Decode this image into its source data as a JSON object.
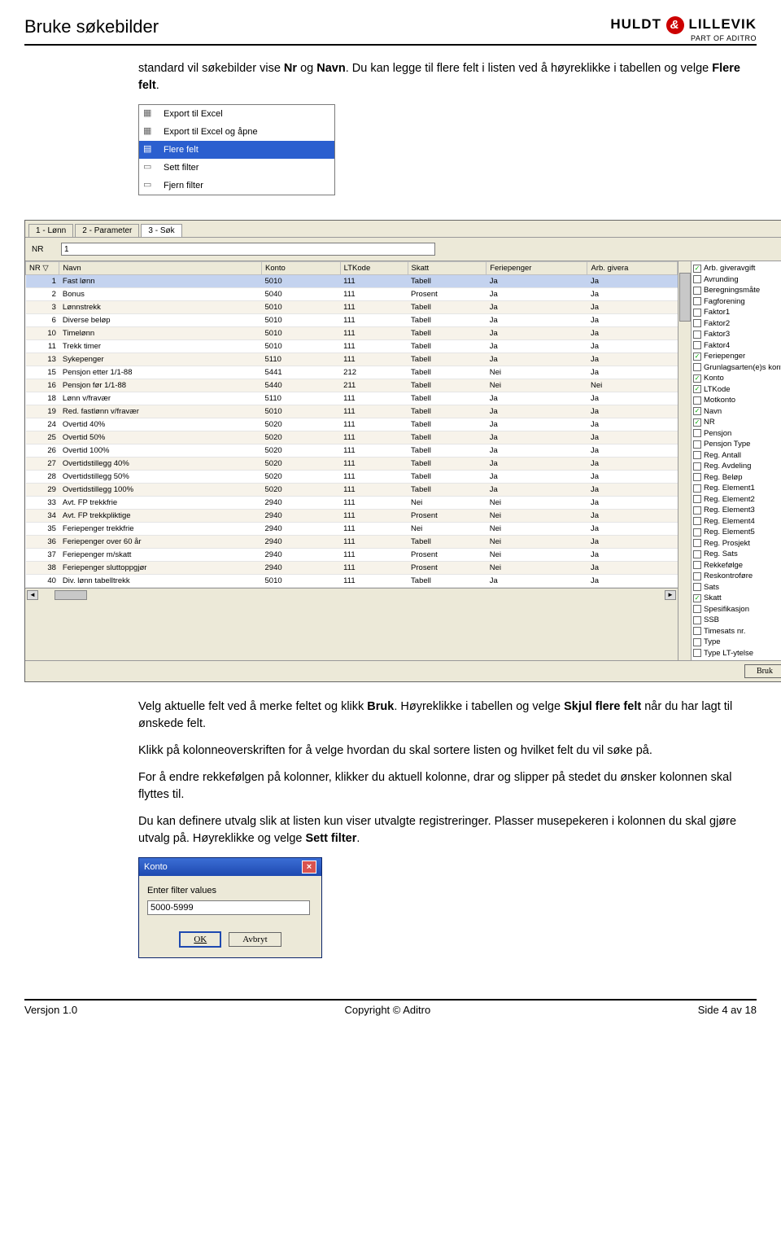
{
  "header": {
    "doc_title": "Bruke søkebilder",
    "logo_left": "HULDT",
    "logo_right": "LILLEVIK",
    "logo_sub": "PART OF ADITRO"
  },
  "intro_para_pre": "standard vil søkebilder vise ",
  "intro_bold1": "Nr",
  "intro_mid": " og ",
  "intro_bold2": "Navn",
  "intro_after": ". Du kan legge til flere felt i listen ved å høyreklikke i tabellen og velge ",
  "intro_bold3": "Flere felt",
  "intro_end": ".",
  "ctx_menu": [
    {
      "label": "Export til Excel",
      "sel": false
    },
    {
      "label": "Export til Excel og åpne",
      "sel": false
    },
    {
      "label": "Flere felt",
      "sel": true
    },
    {
      "label": "Sett filter",
      "sel": false
    },
    {
      "label": "Fjern filter",
      "sel": false
    }
  ],
  "app": {
    "tabs": [
      "1 - Lønn",
      "2 - Parameter",
      "3 - Søk"
    ],
    "active_tab": 2,
    "filter_label": "NR",
    "filter_value": "1",
    "columns": [
      "NR",
      "Navn",
      "Konto",
      "LTKode",
      "Skatt",
      "Feriepenger",
      "Arb. givera"
    ],
    "rows": [
      [
        "1",
        "Fast lønn",
        "5010",
        "111",
        "Tabell",
        "Ja",
        "Ja"
      ],
      [
        "2",
        "Bonus",
        "5040",
        "111",
        "Prosent",
        "Ja",
        "Ja"
      ],
      [
        "3",
        "Lønnstrekk",
        "5010",
        "111",
        "Tabell",
        "Ja",
        "Ja"
      ],
      [
        "6",
        "Diverse beløp",
        "5010",
        "111",
        "Tabell",
        "Ja",
        "Ja"
      ],
      [
        "10",
        "Timelønn",
        "5010",
        "111",
        "Tabell",
        "Ja",
        "Ja"
      ],
      [
        "11",
        "Trekk timer",
        "5010",
        "111",
        "Tabell",
        "Ja",
        "Ja"
      ],
      [
        "13",
        "Sykepenger",
        "5110",
        "111",
        "Tabell",
        "Ja",
        "Ja"
      ],
      [
        "15",
        "Pensjon etter 1/1-88",
        "5441",
        "212",
        "Tabell",
        "Nei",
        "Ja"
      ],
      [
        "16",
        "Pensjon før 1/1-88",
        "5440",
        "211",
        "Tabell",
        "Nei",
        "Nei"
      ],
      [
        "18",
        "Lønn v/fravær",
        "5110",
        "111",
        "Tabell",
        "Ja",
        "Ja"
      ],
      [
        "19",
        "Red. fastlønn v/fravær",
        "5010",
        "111",
        "Tabell",
        "Ja",
        "Ja"
      ],
      [
        "24",
        "Overtid 40%",
        "5020",
        "111",
        "Tabell",
        "Ja",
        "Ja"
      ],
      [
        "25",
        "Overtid 50%",
        "5020",
        "111",
        "Tabell",
        "Ja",
        "Ja"
      ],
      [
        "26",
        "Overtid 100%",
        "5020",
        "111",
        "Tabell",
        "Ja",
        "Ja"
      ],
      [
        "27",
        "Overtidstillegg 40%",
        "5020",
        "111",
        "Tabell",
        "Ja",
        "Ja"
      ],
      [
        "28",
        "Overtidstillegg 50%",
        "5020",
        "111",
        "Tabell",
        "Ja",
        "Ja"
      ],
      [
        "29",
        "Overtidstillegg 100%",
        "5020",
        "111",
        "Tabell",
        "Ja",
        "Ja"
      ],
      [
        "33",
        "Avt. FP trekkfrie",
        "2940",
        "111",
        "Nei",
        "Nei",
        "Ja"
      ],
      [
        "34",
        "Avt. FP trekkpliktige",
        "2940",
        "111",
        "Prosent",
        "Nei",
        "Ja"
      ],
      [
        "35",
        "Feriepenger trekkfrie",
        "2940",
        "111",
        "Nei",
        "Nei",
        "Ja"
      ],
      [
        "36",
        "Feriepenger over 60 år",
        "2940",
        "111",
        "Tabell",
        "Nei",
        "Ja"
      ],
      [
        "37",
        "Feriepenger m/skatt",
        "2940",
        "111",
        "Prosent",
        "Nei",
        "Ja"
      ],
      [
        "38",
        "Feriepenger sluttoppgjør",
        "2940",
        "111",
        "Prosent",
        "Nei",
        "Ja"
      ],
      [
        "40",
        "Div. lønn tabelltrekk",
        "5010",
        "111",
        "Tabell",
        "Ja",
        "Ja"
      ]
    ],
    "fields": [
      {
        "name": "Arb. giveravgift",
        "c": true
      },
      {
        "name": "Avrunding",
        "c": false
      },
      {
        "name": "Beregningsmåte",
        "c": false
      },
      {
        "name": "Fagforening",
        "c": false
      },
      {
        "name": "Faktor1",
        "c": false
      },
      {
        "name": "Faktor2",
        "c": false
      },
      {
        "name": "Faktor3",
        "c": false
      },
      {
        "name": "Faktor4",
        "c": false
      },
      {
        "name": "Feriepenger",
        "c": true
      },
      {
        "name": "Grunlagsarten(e)s kontostreng",
        "c": false
      },
      {
        "name": "Konto",
        "c": true
      },
      {
        "name": "LTKode",
        "c": true
      },
      {
        "name": "Motkonto",
        "c": false
      },
      {
        "name": "Navn",
        "c": true
      },
      {
        "name": "NR",
        "c": true
      },
      {
        "name": "Pensjon",
        "c": false
      },
      {
        "name": "Pensjon Type",
        "c": false
      },
      {
        "name": "Reg. Antall",
        "c": false
      },
      {
        "name": "Reg. Avdeling",
        "c": false
      },
      {
        "name": "Reg. Beløp",
        "c": false
      },
      {
        "name": "Reg. Element1",
        "c": false
      },
      {
        "name": "Reg. Element2",
        "c": false
      },
      {
        "name": "Reg. Element3",
        "c": false
      },
      {
        "name": "Reg. Element4",
        "c": false
      },
      {
        "name": "Reg. Element5",
        "c": false
      },
      {
        "name": "Reg. Prosjekt",
        "c": false
      },
      {
        "name": "Reg. Sats",
        "c": false
      },
      {
        "name": "Rekkefølge",
        "c": false
      },
      {
        "name": "Reskontroføre",
        "c": false
      },
      {
        "name": "Sats",
        "c": false
      },
      {
        "name": "Skatt",
        "c": true
      },
      {
        "name": "Spesifikasjon",
        "c": false
      },
      {
        "name": "SSB",
        "c": false
      },
      {
        "name": "Timesats nr.",
        "c": false
      },
      {
        "name": "Type",
        "c": false
      },
      {
        "name": "Type LT-ytelse",
        "c": false
      }
    ],
    "bruk_label": "Bruk"
  },
  "p2_pre": "Velg aktuelle felt ved å merke feltet og klikk ",
  "p2_bold": "Bruk",
  "p2_mid": ". Høyreklikke i tabellen og velge ",
  "p2_bold2": "Skjul flere felt",
  "p2_end": " når du har lagt til ønskede felt.",
  "p3": "Klikk på kolonneoverskriften for å velge hvordan du skal sortere listen og hvilket felt du vil søke på.",
  "p4": "For å endre rekkefølgen på kolonner, klikker du aktuell kolonne, drar og slipper på stedet du ønsker kolonnen skal flyttes til.",
  "p5_pre": "Du kan definere utvalg slik at listen kun viser utvalgte registreringer. Plasser musepekeren i kolonnen du skal gjøre utvalg på. Høyreklikke og velge ",
  "p5_bold": "Sett filter",
  "p5_end": ".",
  "dialog": {
    "title": "Konto",
    "label": "Enter filter values",
    "value": "5000-5999",
    "ok": "OK",
    "cancel": "Avbryt"
  },
  "footer": {
    "left": "Versjon 1.0",
    "center": "Copyright © Aditro",
    "right": "Side 4 av 18"
  }
}
